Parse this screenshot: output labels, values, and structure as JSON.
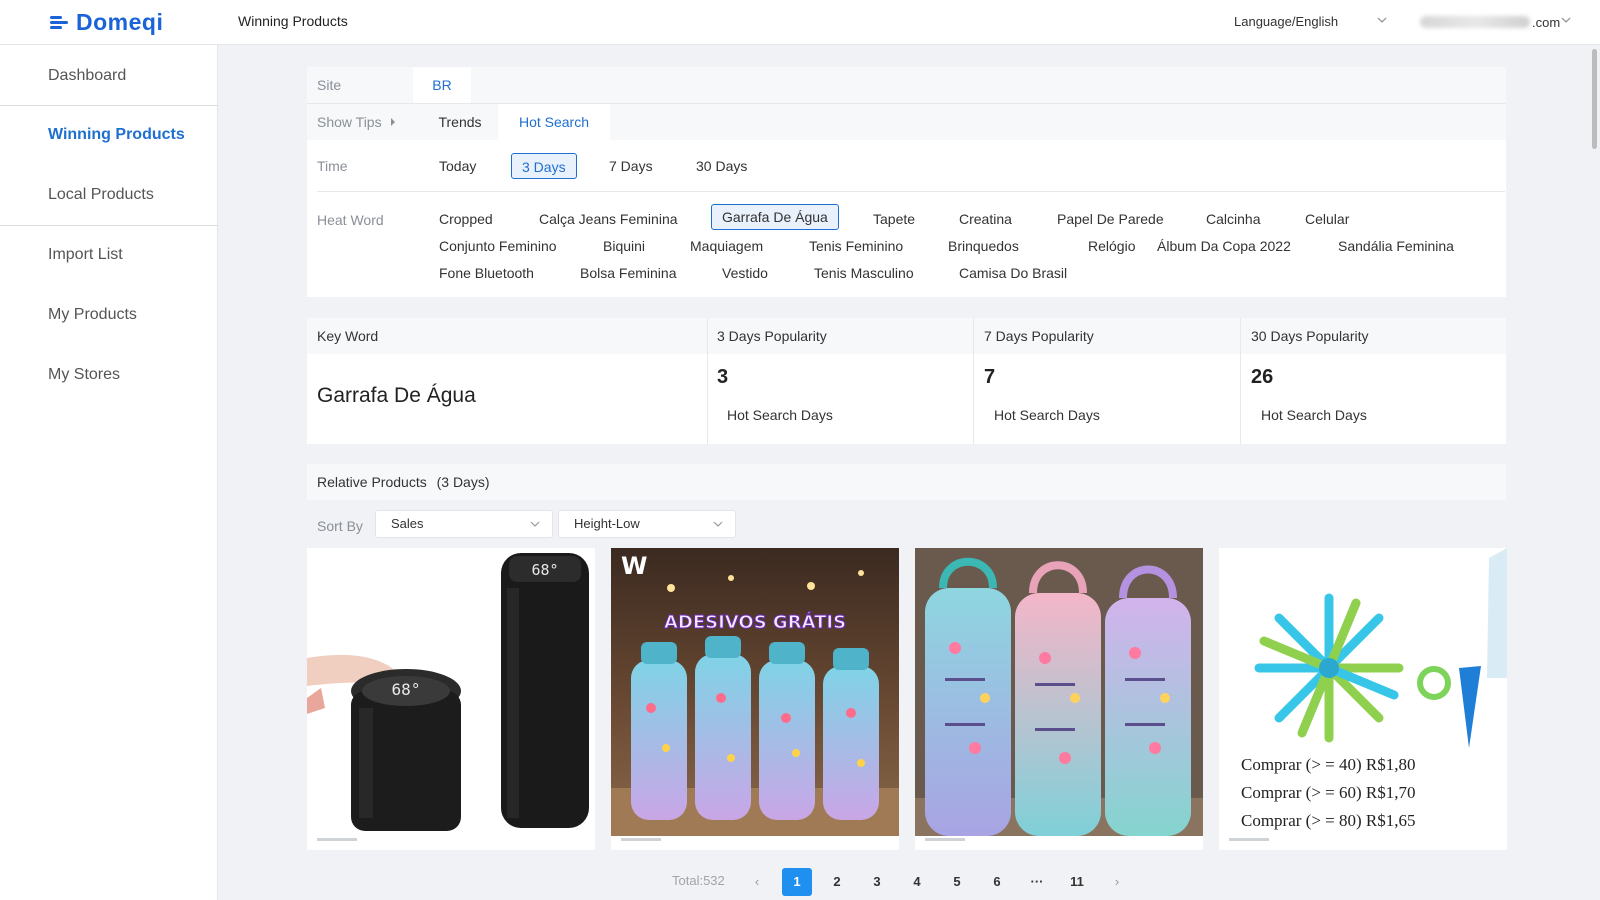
{
  "header": {
    "logo_text": "Domeqi",
    "title": "Winning Products",
    "language": "Language/English",
    "account_suffix": ".com"
  },
  "sidebar": {
    "items": [
      {
        "label": "Dashboard"
      },
      {
        "label": "Winning Products"
      },
      {
        "label": "Local Products"
      },
      {
        "label": "Import List"
      },
      {
        "label": "My Products"
      },
      {
        "label": "My Stores"
      }
    ]
  },
  "filters": {
    "site_label": "Site",
    "site_value": "BR",
    "show_tips": "Show Tips",
    "tabs": [
      "Trends",
      "Hot Search"
    ],
    "time_label": "Time",
    "time_options": [
      "Today",
      "3 Days",
      "7 Days",
      "30 Days"
    ],
    "heat_label": "Heat Word",
    "heat_words": [
      "Cropped",
      "Calça Jeans Feminina",
      "Garrafa De Água",
      "Tapete",
      "Creatina",
      "Papel De Parede",
      "Calcinha",
      "Celular",
      "Conjunto Feminino",
      "Biquini",
      "Maquiagem",
      "Tenis Feminino",
      "Brinquedos",
      "Relógio",
      "Álbum Da Copa 2022",
      "Sandália Feminina",
      "Fone Bluetooth",
      "Bolsa Feminina",
      "Vestido",
      "Tenis Masculino",
      "Camisa Do Brasil"
    ]
  },
  "stats": {
    "keyword_header": "Key Word",
    "keyword": "Garrafa De Água",
    "columns": [
      {
        "title": "3 Days Popularity",
        "value": "3",
        "sub": "Hot Search Days"
      },
      {
        "title": "7 Days Popularity",
        "value": "7",
        "sub": "Hot Search Days"
      },
      {
        "title": "30 Days Popularity",
        "value": "26",
        "sub": "Hot Search Days"
      }
    ]
  },
  "relative": {
    "title": "Relative Products",
    "period": "(3 Days)",
    "sort_label": "Sort By",
    "sort_value": "Sales",
    "order_value": "Height-Low"
  },
  "products": {
    "p1": {
      "display": "68°"
    },
    "p2": {
      "banner": "ADESIVOS GRÁTIS",
      "brand": "W"
    },
    "p4": {
      "lines": [
        "Comprar (> = 40) R$1,80",
        "Comprar (> = 60) R$1,70",
        "Comprar (> = 80) R$1,65"
      ]
    }
  },
  "pagination": {
    "total": "Total:532",
    "pages": [
      "1",
      "2",
      "3",
      "4",
      "5",
      "6",
      "···",
      "11"
    ],
    "prev": "‹",
    "next": "›"
  },
  "colors": {
    "accent": "#1f6fd1",
    "page_active": "#1f8ff0"
  }
}
